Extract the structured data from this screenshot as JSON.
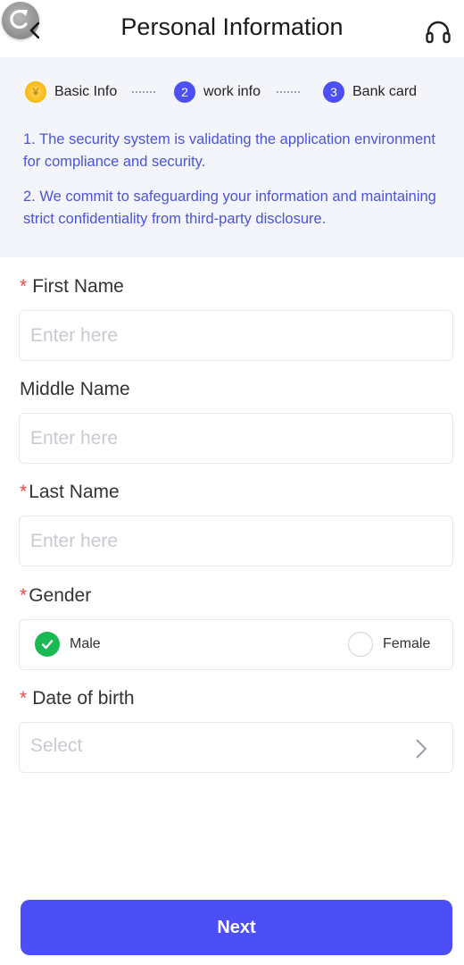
{
  "header": {
    "title": "Personal Information",
    "back_icon": "refresh-back-icon",
    "support_icon": "headset-icon"
  },
  "steps": [
    {
      "label": "Basic Info",
      "marker": "done",
      "icon": "coin-icon"
    },
    {
      "label": "work info",
      "marker": "2"
    },
    {
      "label": "Bank card",
      "marker": "3"
    }
  ],
  "notes": [
    "1. The security system is validating the application environment for compliance and security.",
    "2. We commit to safeguarding your information and maintaining strict confidentiality from third-party disclosure."
  ],
  "form": {
    "first_name": {
      "label": "First Name",
      "required": "*",
      "placeholder": "Enter here"
    },
    "middle_name": {
      "label": "Middle Name",
      "placeholder": "Enter here"
    },
    "last_name": {
      "label": "Last Name",
      "required": "*",
      "placeholder": "Enter here"
    },
    "gender": {
      "label": "Gender",
      "required": "*",
      "options": [
        "Male",
        "Female"
      ],
      "selected": "Male"
    },
    "dob": {
      "label": "Date of birth",
      "required": "*",
      "placeholder": "Select"
    }
  },
  "next_label": "Next",
  "colors": {
    "accent": "#4c50f4",
    "note_text": "#4b54d9",
    "panel_bg": "#f3f5fb",
    "required": "#e5484d",
    "radio_on": "#19b954"
  }
}
